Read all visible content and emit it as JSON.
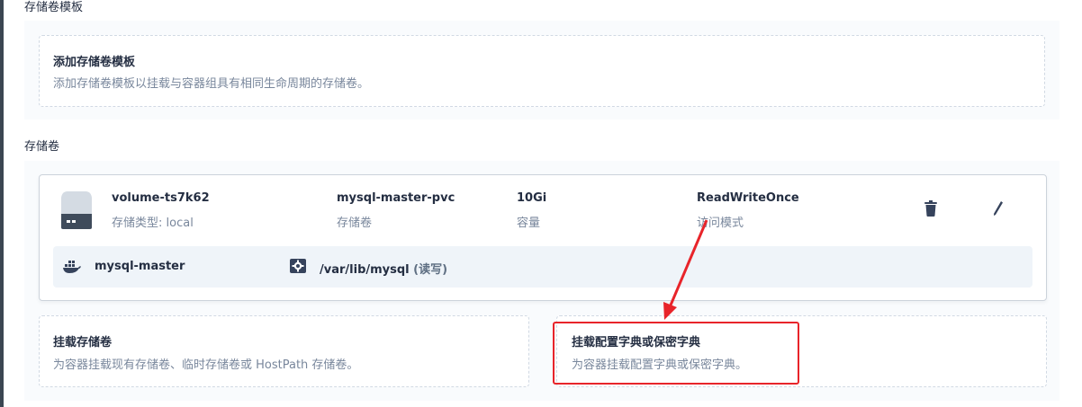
{
  "sections": {
    "template_title": "存储卷模板",
    "volumes_title": "存储卷"
  },
  "add_template": {
    "title": "添加存储卷模板",
    "desc": "添加存储卷模板以挂载与容器组具有相同生命周期的存储卷。"
  },
  "volume": {
    "name": "volume-ts7k62",
    "type_label": "存储类型: local",
    "pvc": "mysql-master-pvc",
    "pvc_label": "存储卷",
    "capacity": "10Gi",
    "capacity_label": "容量",
    "access_mode": "ReadWriteOnce",
    "access_mode_label": "访问模式",
    "icon": "disk-icon",
    "mount": {
      "container": "mysql-master",
      "path": "/var/lib/mysql",
      "mode": "(读写)"
    }
  },
  "mount_volume": {
    "title": "挂载存储卷",
    "desc": "为容器挂载现有存储卷、临时存储卷或 HostPath 存储卷。"
  },
  "mount_config": {
    "title": "挂载配置字典或保密字典",
    "desc": "为容器挂载配置字典或保密字典。"
  },
  "colors": {
    "annotation": "#e8242a",
    "title_text": "#242e42",
    "muted_text": "#79879c"
  }
}
